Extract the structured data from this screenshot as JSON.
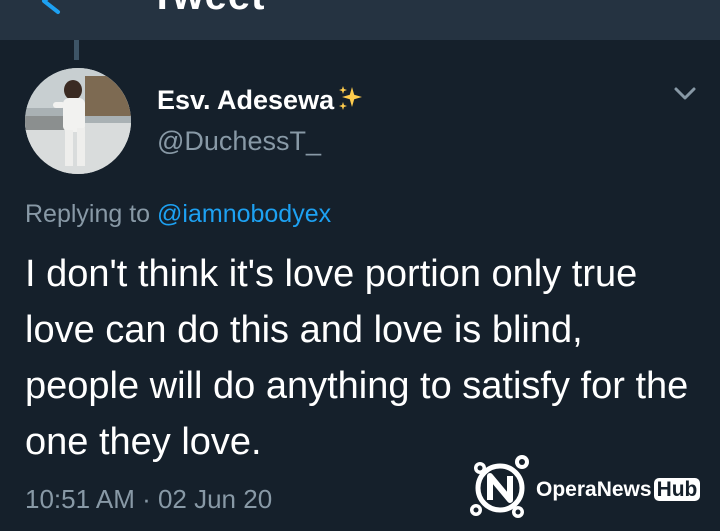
{
  "header": {
    "title": "Tweet",
    "back_icon": "back-arrow-icon"
  },
  "tweet": {
    "display_name": "Esv. Adesewa",
    "name_emoji": "sparkles-icon",
    "handle": "@DuchessT_",
    "menu_icon": "chevron-down-icon",
    "replying_prefix": "Replying to",
    "replying_to": "@iamnobodyex",
    "text": "I don't think it's love portion only true love can do this and love is blind, people will do anything to satisfy for the one they love.",
    "timestamp": "10:51 AM · 02 Jun 20"
  },
  "watermark": {
    "brand": "OperaNews",
    "badge": "Hub"
  },
  "colors": {
    "background": "#15202b",
    "topbar": "#253341",
    "secondary_text": "#8899a6",
    "link": "#1da1f2",
    "sparkle": "#ffcc4d"
  }
}
